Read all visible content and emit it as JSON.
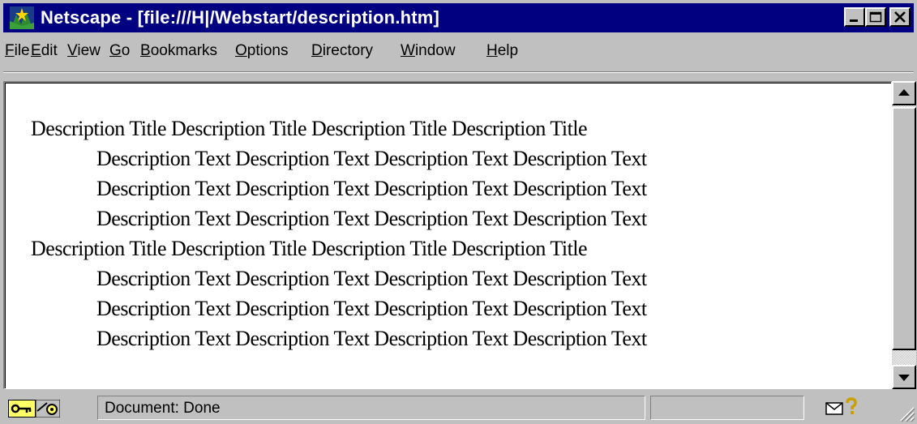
{
  "window": {
    "title": "Netscape - [file:///H|/Webstart/description.htm]"
  },
  "menu": [
    {
      "label": "File",
      "u": "F",
      "rest": "ile"
    },
    {
      "label": "Edit",
      "u": "E",
      "rest": "dit"
    },
    {
      "label": "View",
      "u": "V",
      "rest": "iew"
    },
    {
      "label": "Go",
      "u": "G",
      "rest": "o"
    },
    {
      "label": "Bookmarks",
      "u": "B",
      "rest": "ookmarks"
    },
    {
      "label": "Options",
      "u": "O",
      "rest": "ptions"
    },
    {
      "label": "Directory",
      "u": "D",
      "rest": "irectory"
    },
    {
      "label": "Window",
      "u": "W",
      "rest": "indow"
    },
    {
      "label": "Help",
      "u": "H",
      "rest": "elp"
    }
  ],
  "document": {
    "lines": [
      {
        "kind": "title",
        "text": "Description Title Description Title Description Title Description Title"
      },
      {
        "kind": "text",
        "text": "Description Text Description Text Description Text Description Text"
      },
      {
        "kind": "text",
        "text": "Description Text Description Text Description Text Description Text"
      },
      {
        "kind": "text",
        "text": "Description Text Description Text Description Text Description Text"
      },
      {
        "kind": "title",
        "text": "Description Title Description Title Description Title Description Title"
      },
      {
        "kind": "text",
        "text": "Description Text Description Text Description Text Description Text"
      },
      {
        "kind": "text",
        "text": "Description Text Description Text Description Text Description Text"
      },
      {
        "kind": "text",
        "text": "Description Text Description Text Description Text Description Text"
      }
    ]
  },
  "status": {
    "text": "Document: Done",
    "icons": [
      "security-key-icon",
      "component-bar-icon",
      "mail-icon",
      "help-question-icon"
    ]
  },
  "colors": {
    "titlebar": "#000080",
    "chrome": "#c0c0c0",
    "content_bg": "#ffffff"
  }
}
